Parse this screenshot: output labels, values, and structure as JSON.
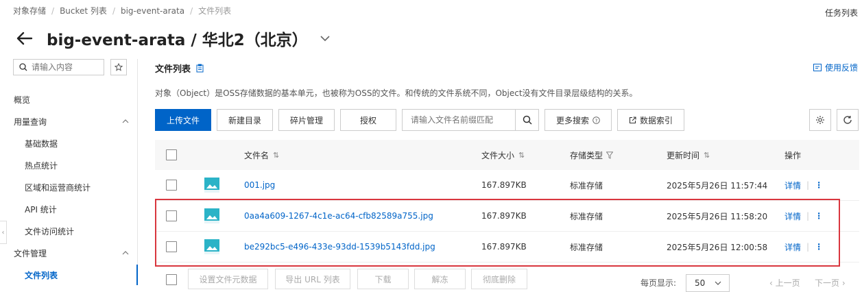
{
  "breadcrumb": {
    "items": [
      "对象存储",
      "Bucket 列表",
      "big-event-arata",
      "文件列表"
    ]
  },
  "header": {
    "title": "big-event-arata / 华北2（北京）",
    "task_list": "任务列表"
  },
  "sidebar": {
    "search_placeholder": "请输入内容",
    "overview": "概览",
    "usage": "用量查询",
    "usage_items": [
      "基础数据",
      "热点统计",
      "区域和运营商统计",
      "API 统计",
      "文件访问统计"
    ],
    "file_mgmt": "文件管理",
    "file_list": "文件列表"
  },
  "main": {
    "section_title": "文件列表",
    "feedback": "使用反馈",
    "description": "对象（Object）是OSS存储数据的基本单元，也被称为OSS的文件。和传统的文件系统不同，Object没有文件目录层级结构的关系。",
    "toolbar": {
      "upload": "上传文件",
      "new_dir": "新建目录",
      "fragments": "碎片管理",
      "authorize": "授权",
      "search_placeholder": "请输入文件名前缀匹配",
      "more_search": "更多搜索",
      "data_index": "数据索引"
    },
    "table": {
      "headers": {
        "name": "文件名",
        "size": "文件大小",
        "storage": "存储类型",
        "updated": "更新时间",
        "actions": "操作"
      },
      "rows": [
        {
          "name": "001.jpg",
          "size": "167.897KB",
          "storage": "标准存储",
          "updated": "2025年5月26日 11:57:44",
          "action": "详情"
        },
        {
          "name": "0aa4a609-1267-4c1e-ac64-cfb82589a755.jpg",
          "size": "167.897KB",
          "storage": "标准存储",
          "updated": "2025年5月26日 11:58:20",
          "action": "详情"
        },
        {
          "name": "be292bc5-e496-433e-93dd-1539b5143fdd.jpg",
          "size": "167.897KB",
          "storage": "标准存储",
          "updated": "2025年5月26日 12:00:58",
          "action": "详情"
        }
      ]
    },
    "bottom": {
      "set_meta": "设置文件元数据",
      "export_url": "导出 URL 列表",
      "download": "下载",
      "unfreeze": "解冻",
      "delete": "彻底删除",
      "per_page_label": "每页显示:",
      "per_page": "50",
      "prev": "上一页",
      "next": "下一页"
    }
  },
  "colors": {
    "primary": "#0064c8",
    "highlight": "#d9363e"
  }
}
